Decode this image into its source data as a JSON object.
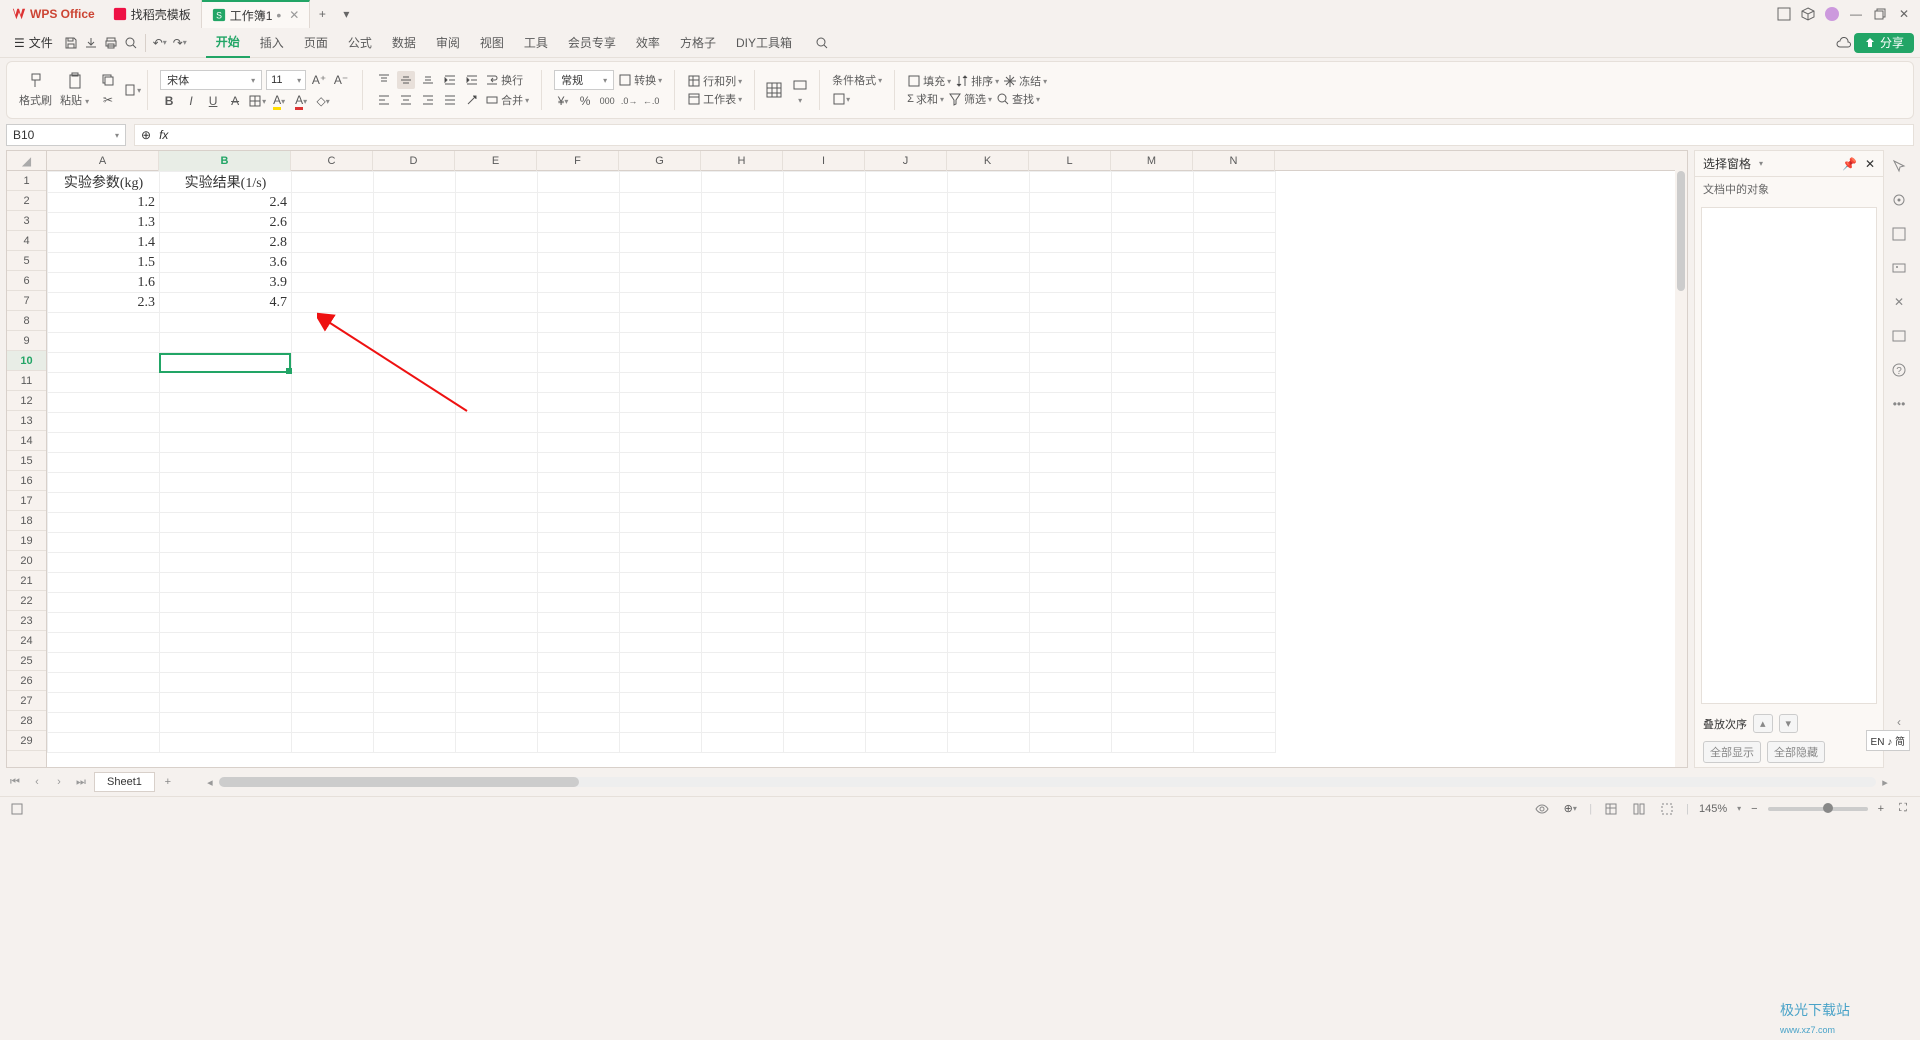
{
  "titlebar": {
    "app_name": "WPS Office",
    "tabs": [
      {
        "icon": "doc-icon-red",
        "label": "找稻壳模板",
        "modified": false
      },
      {
        "icon": "doc-icon-green",
        "label": "工作簿1",
        "modified": true,
        "active": true
      }
    ]
  },
  "menubar": {
    "file_label": "文件",
    "menus": [
      "开始",
      "插入",
      "页面",
      "公式",
      "数据",
      "审阅",
      "视图",
      "工具",
      "会员专享",
      "效率",
      "方格子",
      "DIY工具箱"
    ],
    "active_menu": 0,
    "share_label": "分享"
  },
  "ribbon": {
    "format_painter": "格式刷",
    "paste": "粘贴",
    "font_name": "宋体",
    "font_size": "11",
    "num_format": "常规",
    "wrap": "换行",
    "merge": "合并",
    "convert": "转换",
    "row_col": "行和列",
    "worksheet": "工作表",
    "cond_format": "条件格式",
    "fill": "填充",
    "sort": "排序",
    "freeze": "冻结",
    "sum": "求和",
    "filter": "筛选",
    "find": "查找"
  },
  "fx": {
    "cell_ref": "B10",
    "formula": ""
  },
  "grid": {
    "columns": [
      "A",
      "B",
      "C",
      "D",
      "E",
      "F",
      "G",
      "H",
      "I",
      "J",
      "K",
      "L",
      "M",
      "N"
    ],
    "row_count": 29,
    "active_row": 10,
    "active_col": "B",
    "data": [
      [
        "实验参数(kg)",
        "实验结果(1/s)"
      ],
      [
        "1.2",
        "2.4"
      ],
      [
        "1.3",
        "2.6"
      ],
      [
        "1.4",
        "2.8"
      ],
      [
        "1.5",
        "3.6"
      ],
      [
        "1.6",
        "3.9"
      ],
      [
        "2.3",
        "4.7"
      ]
    ]
  },
  "sheets": {
    "active": "Sheet1"
  },
  "side_pane": {
    "title": "选择窗格",
    "subtitle": "文档中的对象",
    "stack_label": "叠放次序",
    "show_all": "全部显示",
    "hide_all": "全部隐藏"
  },
  "status": {
    "zoom": "145%",
    "ime": "EN ♪ 简"
  },
  "watermark": {
    "line1": "极光下载站",
    "line2": "www.xz7.com"
  }
}
